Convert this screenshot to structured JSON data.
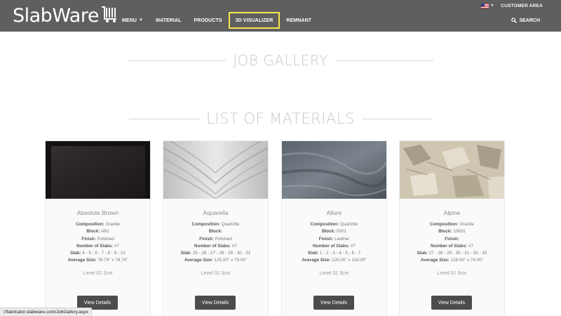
{
  "header": {
    "logo": "SlabWare",
    "customer_area": "CUSTOMER AREA",
    "search": "SEARCH",
    "nav": [
      {
        "label": "MENU",
        "has_caret": true
      },
      {
        "label": "MATERIAL"
      },
      {
        "label": "PRODUCTS"
      },
      {
        "label": "3D VISUALIZER",
        "highlighted": true
      },
      {
        "label": "REMNANT"
      }
    ],
    "colors": {
      "bar": "#5f5f5f",
      "highlight": "#f6e84a"
    }
  },
  "sections": {
    "job_gallery": "JOB GALLERY",
    "list_of_materials": "LIST OF MATERIALS"
  },
  "labels": {
    "composition": "Composition:",
    "block": "Block:",
    "finish": "Finish:",
    "number_of_slabs": "Number of Slabs:",
    "slab": "Slab:",
    "average_size": "Average Size:"
  },
  "materials": [
    {
      "name": "Absolute Brown",
      "composition": "Granite",
      "block": "AB1",
      "finish": "Polished",
      "number_of_slabs": "#7",
      "slab": "4 - 5 - 6 - 7 - 8 - 9 - 10",
      "average_size": "78.74'' x 78.74''",
      "level": "Level 02 2cm",
      "button": "View Details"
    },
    {
      "name": "Aquarella",
      "composition": "Quartzite",
      "block": "",
      "finish": "Polished",
      "number_of_slabs": "#7",
      "slab": "25 - 26 - 27 - 28 - 29 - 30 - 31",
      "average_size": "125.00'' x 79.00''",
      "level": "Level 02 3cm",
      "button": "View Details"
    },
    {
      "name": "Allure",
      "composition": "Quartzite",
      "block": "0001",
      "finish": "Leather",
      "number_of_slabs": "#7",
      "slab": "1 - 2 - 3 - 4 - 5 - 6 - 7",
      "average_size": "120.00'' x 119.00''",
      "level": "Level 02 3cm",
      "button": "View Details"
    },
    {
      "name": "Alpine",
      "composition": "Granite",
      "block": "10631",
      "finish": "",
      "number_of_slabs": "#7",
      "slab": "27 - 28 - 29 - 30 - 31 - 32 - 33",
      "average_size": "128.00'' x 74.00''",
      "level": "Level 02 3cm",
      "button": "View Details"
    }
  ],
  "status_bar": {
    "url": "://fabricator.slabware.com/JobGallery.aspx"
  }
}
